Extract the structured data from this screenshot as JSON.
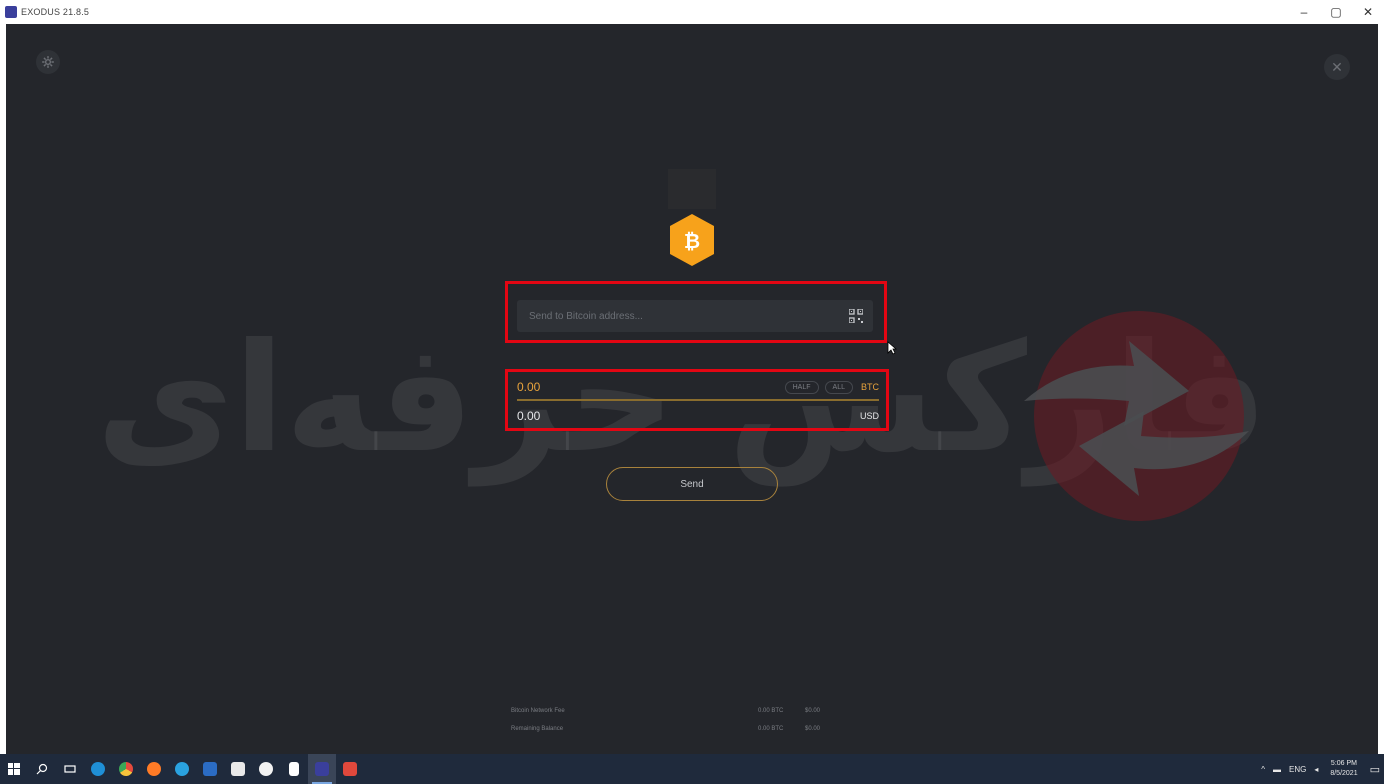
{
  "window": {
    "title": "EXODUS 21.8.5",
    "minimize": "–",
    "maximize": "▢",
    "close": "✕"
  },
  "watermark": {
    "text": "فارکس حرفه‌ای"
  },
  "send_form": {
    "coin": "Bitcoin",
    "coin_symbol": "₿",
    "address_placeholder": "Send to Bitcoin address...",
    "amount_btc": "0.00",
    "amount_usd": "0.00",
    "half_label": "HALF",
    "all_label": "ALL",
    "btc_unit": "BTC",
    "usd_unit": "USD",
    "send_label": "Send"
  },
  "fees": [
    {
      "label": "Bitcoin Network Fee",
      "btc": "0.00 BTC",
      "usd": "$0.00"
    },
    {
      "label": "Remaining Balance",
      "btc": "0.00 BTC",
      "usd": "$0.00"
    }
  ],
  "taskbar": {
    "time": "5:06 PM",
    "date": "8/5/2021",
    "lang": "ENG",
    "pinned": [
      "start",
      "search",
      "task-view",
      "edge",
      "chrome",
      "firefox",
      "app",
      "word",
      "store",
      "app2",
      "notepad",
      "exodus",
      "app3"
    ]
  },
  "colors": {
    "accent": "#e8a33c",
    "highlight": "#e30613",
    "background": "#24262b"
  }
}
